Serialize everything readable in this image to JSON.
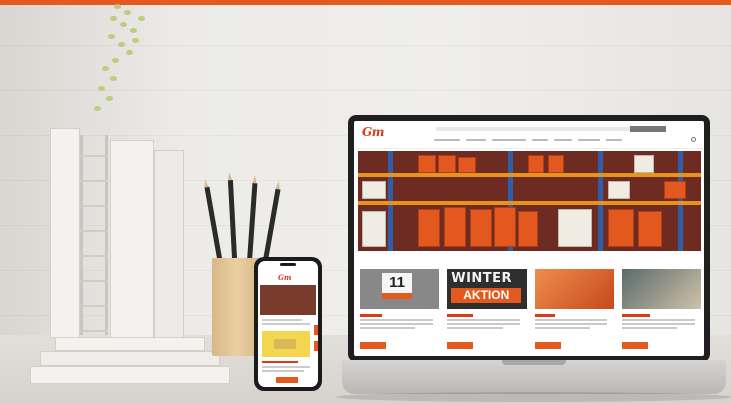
{
  "scene": {
    "accent_color": "#e45a1e",
    "brand_color": "#d93a1a"
  },
  "laptop_site": {
    "logo": "Gm",
    "hero_description": "warehouse shelving with orange and white boxes",
    "cards": [
      {
        "image_text": "11",
        "icon": "calendar-badge"
      },
      {
        "image_line1": "WINTER",
        "image_line2": "AKTION"
      },
      {
        "icon": "product-cans-image"
      },
      {
        "icon": "shop-interior-image"
      }
    ]
  },
  "phone_site": {
    "logo": "Gm"
  }
}
